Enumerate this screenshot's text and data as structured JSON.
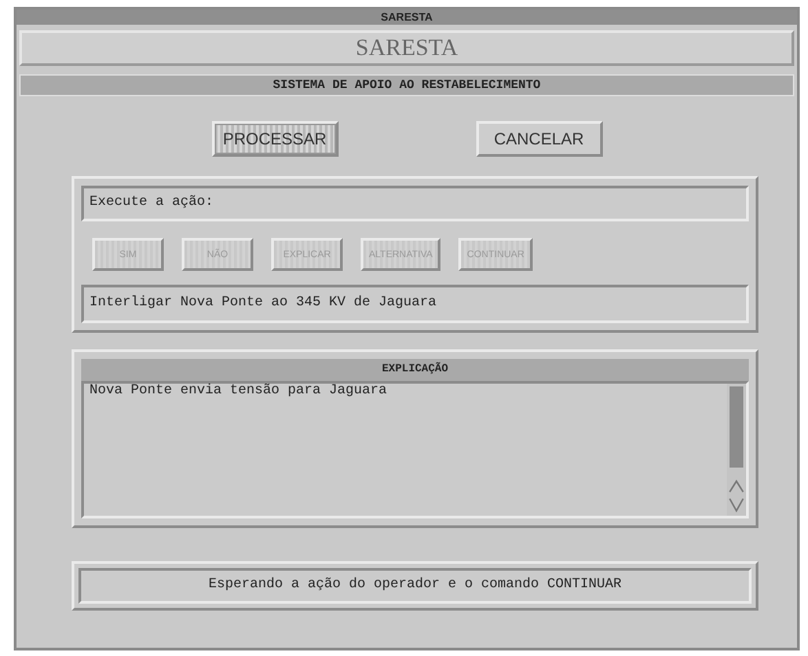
{
  "window": {
    "title": "SARESTA"
  },
  "header": {
    "title": "SARESTA",
    "subtitle": "SISTEMA DE APOIO AO RESTABELECIMENTO"
  },
  "main_buttons": [
    {
      "label": "PROCESSAR",
      "selected": true
    },
    {
      "label": "CANCELAR",
      "selected": false
    }
  ],
  "action_panel": {
    "prompt": "Execute a ação:",
    "buttons": [
      {
        "label": "SIM",
        "disabled": true
      },
      {
        "label": "NÃO",
        "disabled": true
      },
      {
        "label": "EXPLICAR",
        "disabled": true
      },
      {
        "label": "ALTERNATIVA",
        "disabled": true
      },
      {
        "label": "CONTINUAR",
        "disabled": true
      }
    ],
    "action": "Interligar Nova Ponte ao 345 KV de Jaguara"
  },
  "explanation": {
    "title": "EXPLICAÇÃO",
    "text": "Nova Ponte envia tensão para Jaguara"
  },
  "status_bar": "Esperando a ação do operador e o comando CONTINUAR"
}
